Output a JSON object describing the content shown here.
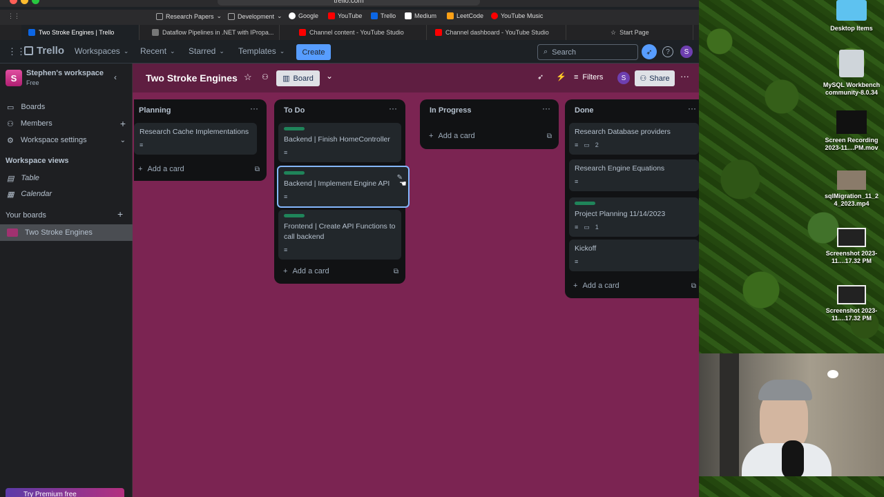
{
  "browser": {
    "url": "trello.com",
    "bookmarks": [
      {
        "label": "Research Papers",
        "icon": "folder-icon",
        "dropdown": true
      },
      {
        "label": "Development",
        "icon": "folder-icon",
        "dropdown": true
      },
      {
        "label": "Google",
        "icon": "google-icon"
      },
      {
        "label": "YouTube",
        "icon": "youtube-icon"
      },
      {
        "label": "Trello",
        "icon": "trello-icon"
      },
      {
        "label": "Medium",
        "icon": "medium-icon"
      },
      {
        "label": "LeetCode",
        "icon": "leetcode-icon"
      },
      {
        "label": "YouTube Music",
        "icon": "youtube-music-icon"
      }
    ],
    "tabs": [
      {
        "label": "Two Stroke Engines | Trello",
        "active": true
      },
      {
        "label": "Dataflow Pipelines in .NET with IPropa..."
      },
      {
        "label": "Channel content - YouTube Studio"
      },
      {
        "label": "Channel dashboard - YouTube Studio"
      },
      {
        "label": "Start Page"
      }
    ]
  },
  "nav": {
    "brand": "Trello",
    "workspaces": "Workspaces",
    "recent": "Recent",
    "starred": "Starred",
    "templates": "Templates",
    "create": "Create",
    "search_placeholder": "Search",
    "avatar": "S"
  },
  "sidebar": {
    "workspace_initial": "S",
    "workspace_name": "Stephen's workspace",
    "workspace_plan": "Free",
    "items": [
      {
        "label": "Boards"
      },
      {
        "label": "Members"
      },
      {
        "label": "Workspace settings"
      }
    ],
    "views_header": "Workspace views",
    "views": [
      {
        "label": "Table"
      },
      {
        "label": "Calendar"
      }
    ],
    "boards_header": "Your boards",
    "boards": [
      {
        "label": "Two Stroke Engines"
      }
    ],
    "premium": "Try Premium free"
  },
  "board": {
    "title": "Two Stroke Engines",
    "view": "Board",
    "filters": "Filters",
    "share": "Share",
    "member": "S",
    "add_card": "Add a card",
    "lists": [
      {
        "name": "Planning",
        "cards": [
          {
            "title": "Research Cache Implementations",
            "label": false,
            "desc": true,
            "comments": ""
          }
        ]
      },
      {
        "name": "To Do",
        "cards": [
          {
            "title": "Backend | Finish HomeController",
            "label": true,
            "desc": true,
            "comments": ""
          },
          {
            "title": "Backend | Implement Engine API",
            "label": true,
            "desc": true,
            "comments": ""
          },
          {
            "title": "Frontend | Create API Functions to call backend",
            "label": true,
            "desc": true,
            "comments": ""
          }
        ]
      },
      {
        "name": "In Progress",
        "cards": []
      },
      {
        "name": "Done",
        "cards": [
          {
            "title": "Research Database providers",
            "label": false,
            "desc": true,
            "comments": "2"
          },
          {
            "title": "Research Engine Equations",
            "label": false,
            "desc": true,
            "comments": ""
          },
          {
            "title": "Project Planning 11/14/2023",
            "label": true,
            "desc": true,
            "comments": "1"
          },
          {
            "title": "Kickoff",
            "label": false,
            "desc": true,
            "comments": ""
          }
        ]
      }
    ]
  },
  "desktop": {
    "icons": [
      {
        "label": "Desktop Items"
      },
      {
        "label": "MySQL Workbench community-8.0.34"
      },
      {
        "label": "Screen Recording 2023-11....PM.mov"
      },
      {
        "label": "sqlMigration_11_2 4_2023.mp4"
      },
      {
        "label": "Screenshot 2023-11....17.32 PM"
      },
      {
        "label": "Screenshot 2023-11....17.32 PM"
      }
    ]
  },
  "colors": {
    "board_bg": "#7b2452",
    "accent": "#579dff",
    "label_green": "#1f845a",
    "list_bg": "#111214",
    "card_bg": "#22272b"
  }
}
